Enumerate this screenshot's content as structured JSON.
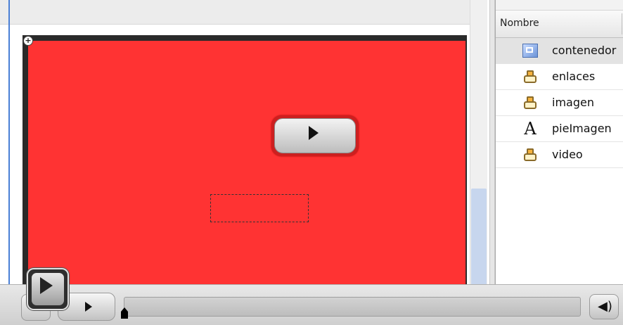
{
  "panel": {
    "column_header": "Nombre",
    "items": [
      {
        "label": "contenedor",
        "icon": "movieclip-frame-icon",
        "selected": true
      },
      {
        "label": "enlaces",
        "icon": "hand-icon",
        "selected": false
      },
      {
        "label": "imagen",
        "icon": "hand-icon",
        "selected": false
      },
      {
        "label": "pieImagen",
        "icon": "text-icon",
        "selected": false
      },
      {
        "label": "video",
        "icon": "hand-icon",
        "selected": false
      }
    ]
  },
  "stage": {
    "background_color": "#ff3333",
    "plus_glyph": "+"
  },
  "controls": {
    "progress": 0,
    "text_icon_glyph": "A",
    "volume_glyph": "◀)"
  },
  "colors": {
    "accent_blue": "#4a7fd6",
    "frame_dark": "#2a2a2a"
  }
}
